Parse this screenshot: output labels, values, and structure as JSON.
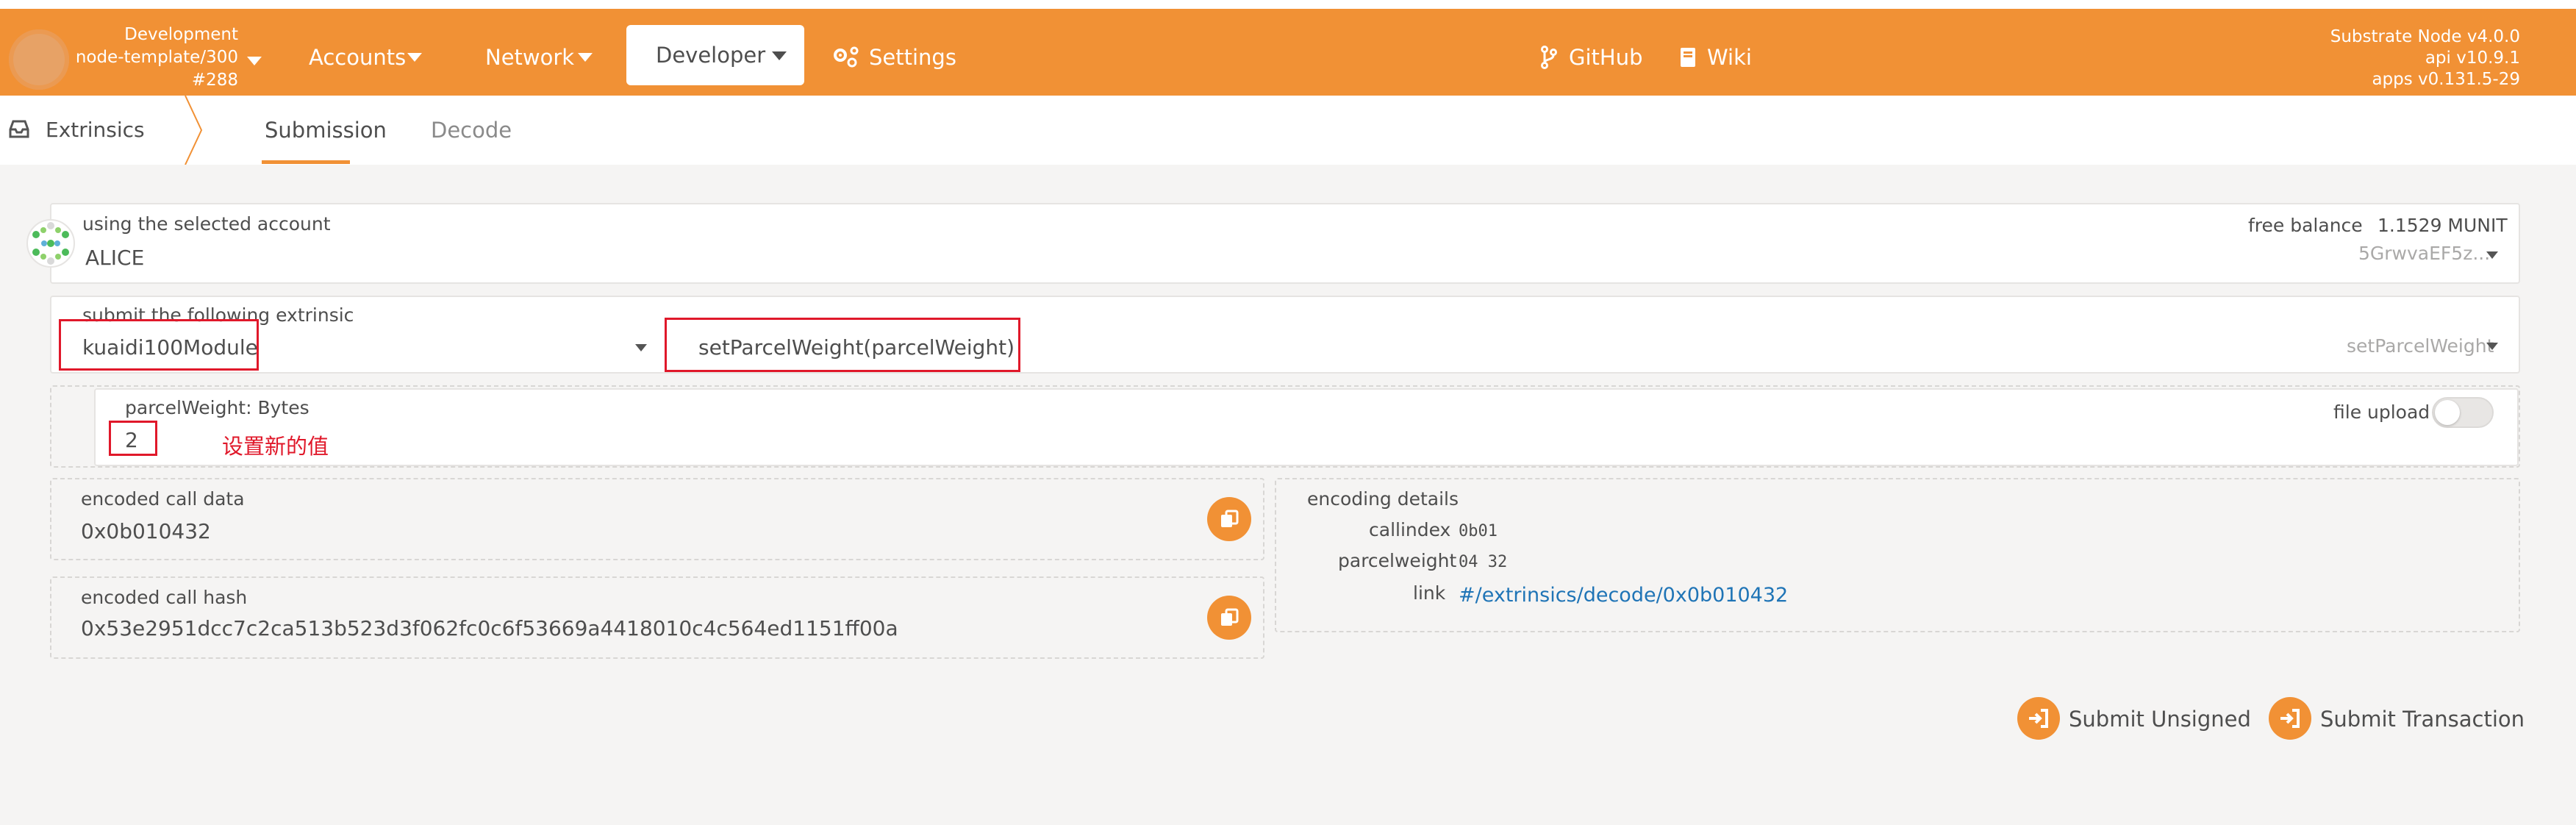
{
  "chain": {
    "name": "Development",
    "node": "node-template/300",
    "block": "#288"
  },
  "menu": {
    "accounts": "Accounts",
    "network": "Network",
    "developer": "Developer",
    "settings": "Settings",
    "github": "GitHub",
    "wiki": "Wiki"
  },
  "version": {
    "node": "Substrate Node v4.0.0",
    "api": "api v10.9.1",
    "apps": "apps v0.131.5-29"
  },
  "tabs": {
    "root": "Extrinsics",
    "items": [
      "Submission",
      "Decode"
    ]
  },
  "account": {
    "label": "using the selected account",
    "name": "ALICE",
    "balance_label": "free balance",
    "balance_value": "1.1529 MUNIT",
    "address": "5GrwvaEF5z..."
  },
  "extrinsic": {
    "label": "submit the following extrinsic",
    "module": "kuaidi100Module",
    "method": "setParcelWeight(parcelWeight)",
    "method_short": "setParcelWeight"
  },
  "param": {
    "label": "parcelWeight: Bytes",
    "value": "2",
    "annotation": "设置新的值",
    "file_upload": "file upload"
  },
  "encoded": {
    "call_data_label": "encoded call data",
    "call_data": "0x0b010432",
    "call_hash_label": "encoded call hash",
    "call_hash": "0x53e2951dcc7c2ca513b523d3f062fc0c6f53669a4418010c4c564ed1151ff00a"
  },
  "encoding_details": {
    "title": "encoding details",
    "callindex_label": "callindex",
    "callindex": "0b01",
    "parcelweight_label": "parcelweight",
    "parcelweight": "04 32",
    "link_label": "link",
    "link": "#/extrinsics/decode/0x0b010432"
  },
  "actions": {
    "submit_unsigned": "Submit Unsigned",
    "submit_transaction": "Submit Transaction"
  },
  "colors": {
    "accent": "#f19135",
    "annotation": "#e0182a",
    "link": "#1f74b6"
  }
}
